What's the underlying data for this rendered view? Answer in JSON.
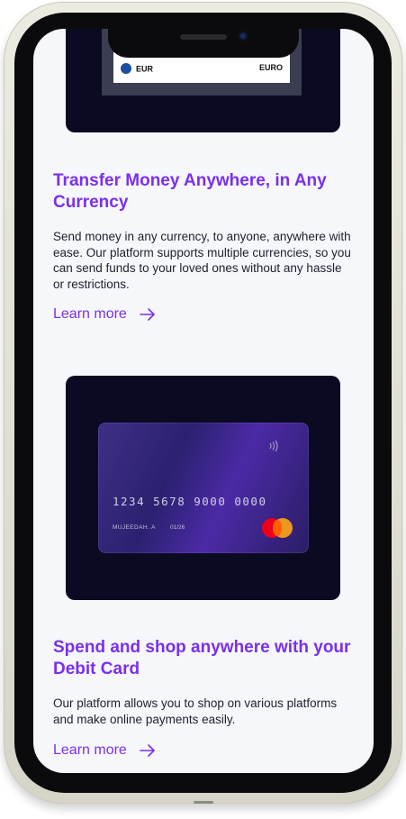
{
  "currency_card": {
    "code": "EUR",
    "name": "EURO"
  },
  "transfer_section": {
    "heading": "Transfer Money Anywhere, in Any Currency",
    "body": "Send money in any currency, to anyone, anywhere with ease. Our platform supports multiple currencies, so you can send funds to your loved ones without any hassle or restrictions.",
    "link_label": "Learn more"
  },
  "debit_card": {
    "number": "1234 5678 9000 0000",
    "holder": "MUJEEDAH. A",
    "expiry": "01/26"
  },
  "shop_section": {
    "heading": "Spend and shop anywhere with your Debit Card",
    "body": "Our platform allows you to shop on various platforms and make online payments easily.",
    "link_label": "Learn more"
  },
  "colors": {
    "accent": "#7a2ff0",
    "dark_panel": "#0a0a23",
    "screen_bg": "#f6f7fb"
  },
  "icons": [
    "arrow-right-icon",
    "contactless-icon",
    "mastercard-logo",
    "euro-flag-icon"
  ]
}
